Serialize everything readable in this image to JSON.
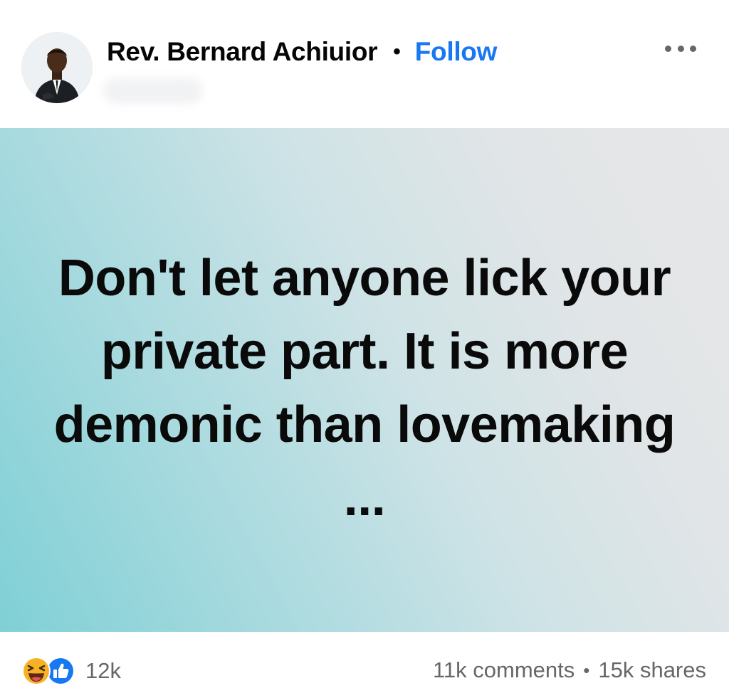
{
  "post": {
    "author_name": "Rev. Bernard Achiuior",
    "separator": "•",
    "follow_label": "Follow",
    "text": "Don't let anyone lick your private part. It is more demonic than lovemaking ...",
    "background_gradient": [
      "#7fd0d6",
      "#e6e7e8"
    ],
    "accent_color": "#1877f2"
  },
  "icons": {
    "more": "more-options-icon",
    "reaction_haha": "haha-reaction-icon",
    "reaction_like": "like-reaction-icon"
  },
  "footer": {
    "reaction_count": "12k",
    "comments": "11k comments",
    "separator": "•",
    "shares": "15k shares"
  }
}
